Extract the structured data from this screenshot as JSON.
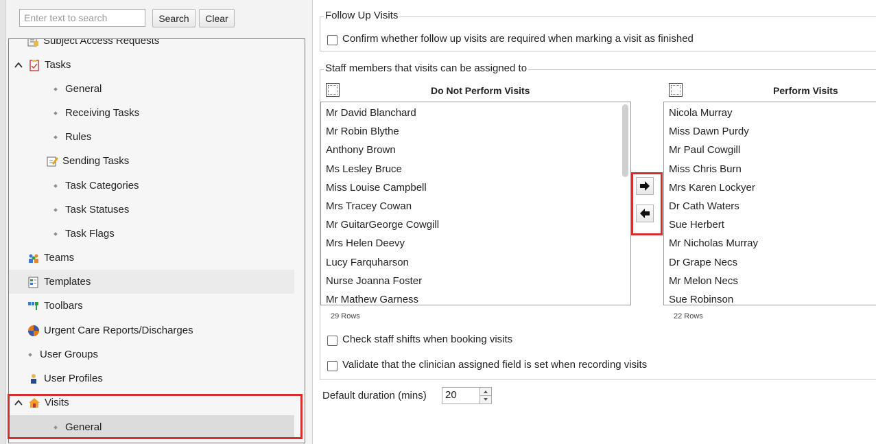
{
  "search": {
    "placeholder": "Enter text to search",
    "button_label": "Search",
    "clear_label": "Clear"
  },
  "tree": {
    "items": [
      {
        "label": "Subject Access Requests",
        "kind": "icon",
        "icon": "document-icon"
      },
      {
        "label": "Tasks",
        "kind": "expanded-icon",
        "icon": "clipboard-icon"
      },
      {
        "label": "General",
        "kind": "bullet"
      },
      {
        "label": "Receiving Tasks",
        "kind": "bullet"
      },
      {
        "label": "Rules",
        "kind": "bullet"
      },
      {
        "label": "Sending Tasks",
        "kind": "icon",
        "icon": "edit-note-icon"
      },
      {
        "label": "Task Categories",
        "kind": "bullet"
      },
      {
        "label": "Task Statuses",
        "kind": "bullet"
      },
      {
        "label": "Task Flags",
        "kind": "bullet"
      },
      {
        "label": "Teams",
        "kind": "icon",
        "icon": "people-icon"
      },
      {
        "label": "Templates",
        "kind": "icon",
        "icon": "template-icon"
      },
      {
        "label": "Toolbars",
        "kind": "icon",
        "icon": "toolbar-icon"
      },
      {
        "label": "Urgent Care Reports/Discharges",
        "kind": "icon",
        "icon": "clock-icon"
      },
      {
        "label": "User Groups",
        "kind": "bullet"
      },
      {
        "label": "User Profiles",
        "kind": "icon",
        "icon": "user-icon"
      },
      {
        "label": "Visits",
        "kind": "expanded-icon",
        "icon": "house-icon"
      },
      {
        "label": "General",
        "kind": "bullet",
        "selected": true
      }
    ]
  },
  "follow_up": {
    "group_title": "Follow Up Visits",
    "confirm_label": "Confirm whether follow up visits are required when marking a visit as finished"
  },
  "staff": {
    "group_title": "Staff members that visits can be assigned to",
    "do_not_perform": {
      "header": "Do Not Perform Visits",
      "rows_label": "29 Rows",
      "items": [
        "Mr David Blanchard",
        "Mr Robin Blythe",
        "Anthony Brown",
        "Ms Lesley Bruce",
        "Miss Louise Campbell",
        "Mrs Tracey Cowan",
        "Mr GuitarGeorge Cowgill",
        "Mrs Helen Deevy",
        "Lucy Farquharson",
        "Nurse Joanna Foster",
        "Mr Mathew Garness"
      ]
    },
    "perform": {
      "header": "Perform Visits",
      "rows_label": "22 Rows",
      "items": [
        "Nicola Murray",
        "Miss Dawn Purdy",
        "Mr Paul Cowgill",
        "Miss Chris Burn",
        "Mrs Karen Lockyer",
        "Dr Cath Waters",
        "Sue Herbert",
        "Mr Nicholas Murray",
        "Dr Grape Necs",
        "Mr Melon Necs",
        "Sue Robinson"
      ]
    },
    "check_shifts_label": "Check staff shifts when booking visits",
    "validate_clinician_label": "Validate that the clinician assigned field is set when recording visits"
  },
  "duration": {
    "label": "Default duration (mins)",
    "value": "20"
  },
  "colors": {
    "highlight": "#d72d2d"
  }
}
